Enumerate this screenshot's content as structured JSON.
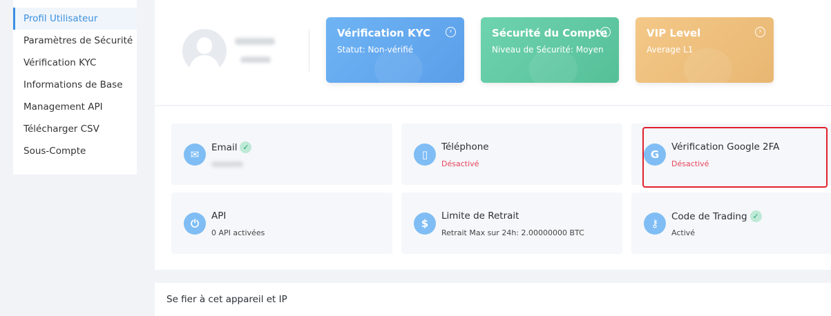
{
  "sidebar": {
    "items": [
      {
        "label": "Profil Utilisateur",
        "active": true
      },
      {
        "label": "Paramètres de Sécurité"
      },
      {
        "label": "Vérification KYC"
      },
      {
        "label": "Informations de Base"
      },
      {
        "label": "Management API"
      },
      {
        "label": "Télécharger CSV"
      },
      {
        "label": "Sous-Compte"
      }
    ]
  },
  "status_cards": {
    "kyc": {
      "title": "Vérification KYC",
      "subtitle": "Statut: Non-vérifié",
      "color": "#62a8ee"
    },
    "security": {
      "title": "Sécurité du Compte",
      "subtitle": "Niveau de Sécurité: Moyen",
      "color": "#5ec8a2"
    },
    "vip": {
      "title": "VIP Level",
      "subtitle": "Average L1",
      "color": "#eebd7c"
    }
  },
  "features": {
    "email": {
      "name": "Email",
      "icon": "mail-icon",
      "verified": true
    },
    "phone": {
      "name": "Téléphone",
      "value": "Désactivé",
      "icon": "phone-icon"
    },
    "google2fa": {
      "name": "Vérification Google 2FA",
      "value": "Désactivé",
      "icon": "google-icon"
    },
    "api": {
      "name": "API",
      "value": "0 API activées",
      "icon": "plug-icon"
    },
    "withdraw": {
      "name": "Limite de Retrait",
      "value": "Retrait Max sur 24h: 2.00000000 BTC",
      "icon": "dollar-icon"
    },
    "trading_code": {
      "name": "Code de Trading",
      "value": "Activé",
      "icon": "key-icon",
      "verified": true
    }
  },
  "trust_device": {
    "label": "Se fier à cet appareil et IP"
  },
  "colors": {
    "accent": "#3b8fe0",
    "danger": "#e8455a",
    "success": "#23a46f",
    "highlight_box": "#e01f2c"
  }
}
